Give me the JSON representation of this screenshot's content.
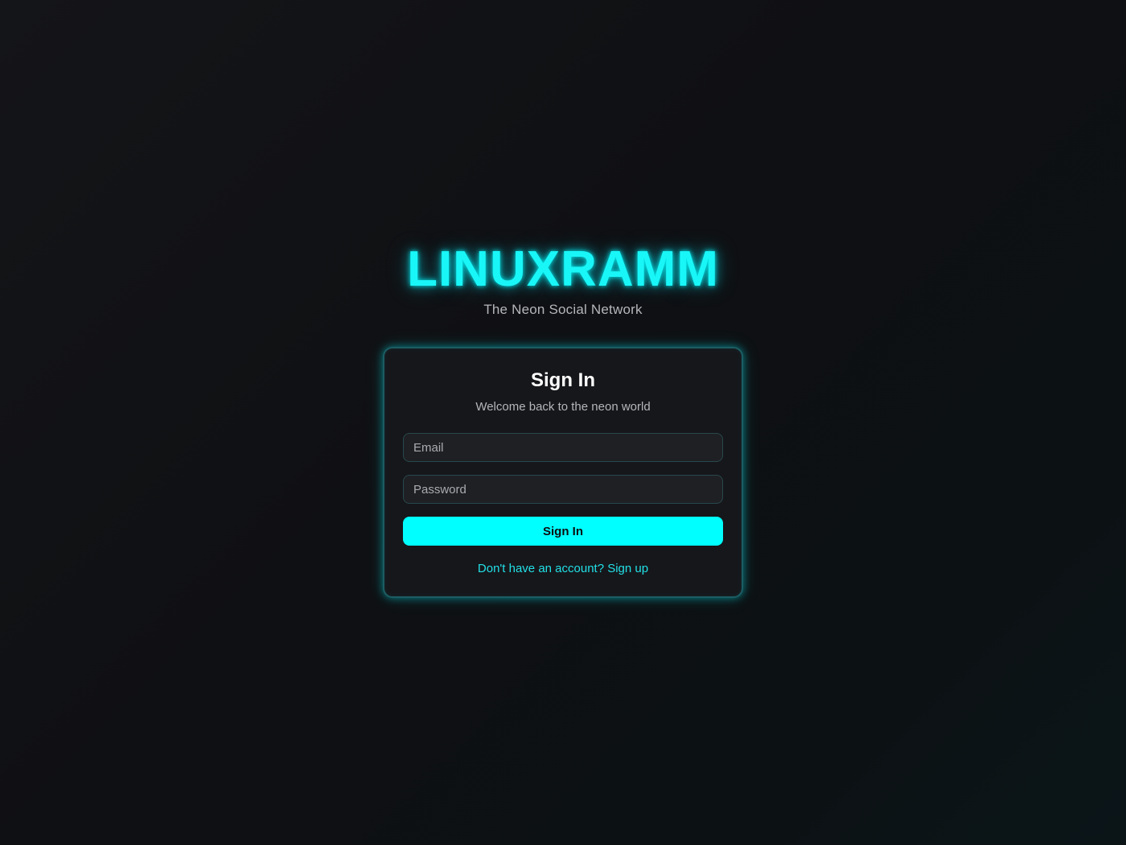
{
  "brand": {
    "title": "LINUXRAMM",
    "tagline": "The Neon Social Network"
  },
  "signin_card": {
    "title": "Sign In",
    "subtitle": "Welcome back to the neon world",
    "email_placeholder": "Email",
    "email_value": "",
    "password_placeholder": "Password",
    "password_value": "",
    "submit_label": "Sign In",
    "signup_link_text": "Don't have an account? Sign up"
  },
  "colors": {
    "accent": "#00ffff",
    "background": "#101114",
    "card": "#16171b",
    "card_border": "#1c5d63"
  }
}
